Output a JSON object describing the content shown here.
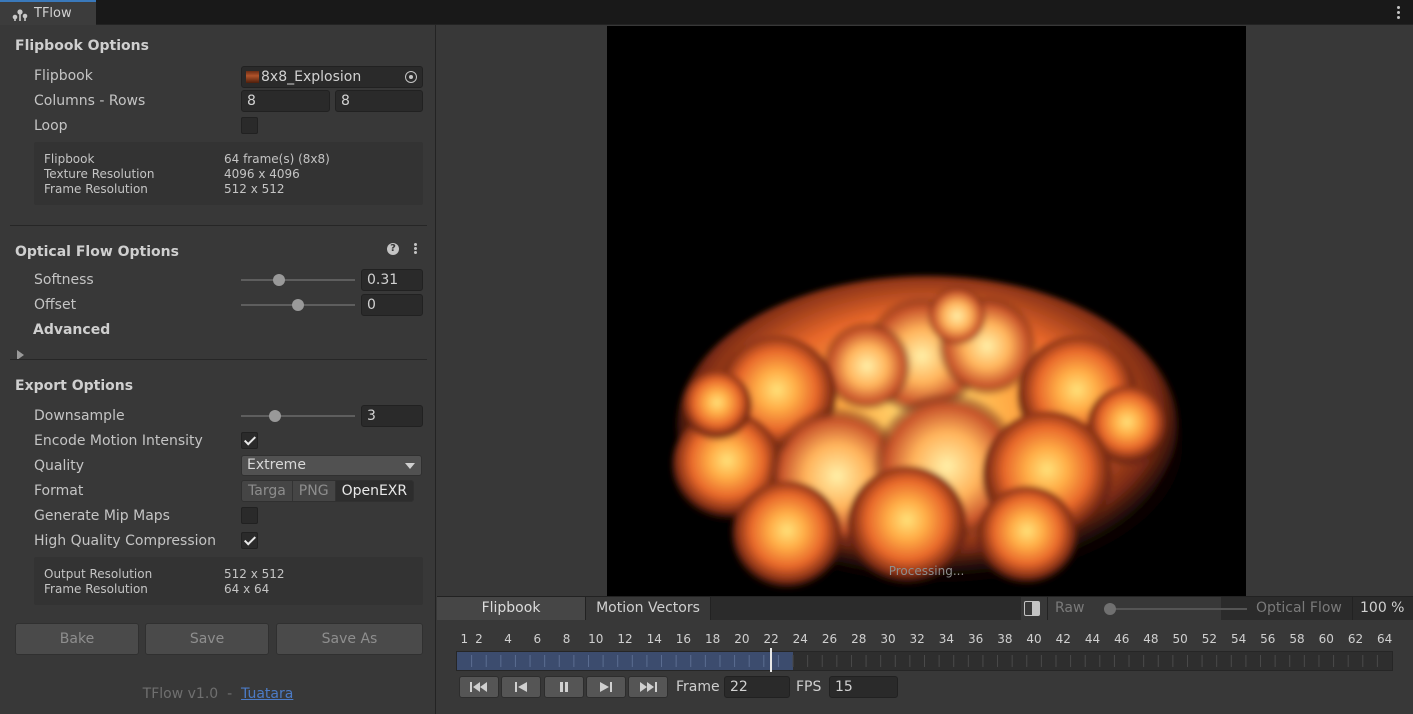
{
  "window": {
    "tab_title": "TFlow"
  },
  "flipbook_options": {
    "title": "Flipbook Options",
    "flipbook_label": "Flipbook",
    "flipbook_value": "8x8_Explosion",
    "columns_rows_label": "Columns - Rows",
    "columns": "8",
    "rows": "8",
    "loop_label": "Loop",
    "loop_checked": false,
    "info": [
      {
        "label": "Flipbook",
        "value": "64 frame(s) (8x8)"
      },
      {
        "label": "Texture Resolution",
        "value": "4096 x 4096"
      },
      {
        "label": "Frame Resolution",
        "value": "512 x 512"
      }
    ]
  },
  "optical_flow_options": {
    "title": "Optical Flow Options",
    "softness_label": "Softness",
    "softness_value": "0.31",
    "softness_slider": 0.31,
    "offset_label": "Offset",
    "offset_value": "0",
    "offset_slider": 0.5,
    "advanced_label": "Advanced"
  },
  "export_options": {
    "title": "Export Options",
    "downsample_label": "Downsample",
    "downsample_value": "3",
    "downsample_slider": 0.27,
    "encode_motion_label": "Encode Motion Intensity",
    "encode_motion_checked": true,
    "quality_label": "Quality",
    "quality_value": "Extreme",
    "format_label": "Format",
    "format_options": [
      "Targa",
      "PNG",
      "OpenEXR"
    ],
    "format_selected": "OpenEXR",
    "mipmaps_label": "Generate Mip Maps",
    "mipmaps_checked": false,
    "hq_compression_label": "High Quality Compression",
    "hq_compression_checked": true,
    "info": [
      {
        "label": "Output Resolution",
        "value": "512 x 512"
      },
      {
        "label": "Frame Resolution",
        "value": "64 x 64"
      }
    ]
  },
  "actions": {
    "bake": "Bake",
    "save": "Save",
    "save_as": "Save As"
  },
  "footer": {
    "version": "TFlow v1.0  -  ",
    "link": "Tuatara"
  },
  "preview": {
    "status": "Processing..."
  },
  "view_bar": {
    "tab_flipbook": "Flipbook",
    "tab_motion_vectors": "Motion Vectors",
    "raw_label": "Raw",
    "optical_flow_label": "Optical Flow",
    "zoom": "100 %",
    "blend_slider": 0.0
  },
  "timeline": {
    "tick_labels": [
      "1",
      "2",
      "4",
      "6",
      "8",
      "10",
      "12",
      "14",
      "16",
      "18",
      "20",
      "22",
      "24",
      "26",
      "28",
      "30",
      "32",
      "34",
      "36",
      "38",
      "40",
      "42",
      "44",
      "46",
      "48",
      "50",
      "52",
      "54",
      "56",
      "58",
      "60",
      "62",
      "64"
    ],
    "total_frames": 64,
    "current_frame": 22,
    "loaded_frames": 23,
    "frame_label": "Frame",
    "frame_value": "22",
    "fps_label": "FPS",
    "fps_value": "15"
  },
  "colors": {
    "accent": "#3a79bb",
    "timeline_fill": "#3c4c6e",
    "link": "#4c7bc6"
  }
}
